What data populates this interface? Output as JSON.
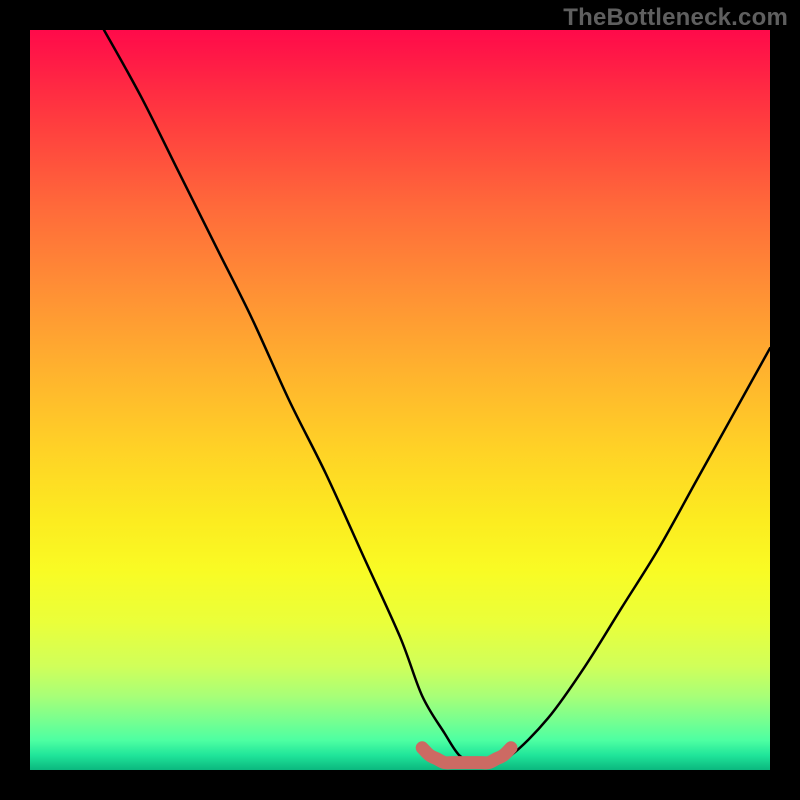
{
  "watermark": "TheBottleneck.com",
  "chart_data": {
    "type": "line",
    "title": "",
    "xlabel": "",
    "ylabel": "",
    "xlim": [
      0,
      100
    ],
    "ylim": [
      0,
      100
    ],
    "grid": false,
    "legend": false,
    "background_gradient": [
      "#ff0a4a",
      "#ffb22e",
      "#fceb20",
      "#20e59a"
    ],
    "series": [
      {
        "name": "bottleneck-curve",
        "color": "#000000",
        "x": [
          10,
          15,
          20,
          25,
          30,
          35,
          40,
          45,
          50,
          53,
          56,
          58,
          60,
          62,
          65,
          70,
          75,
          80,
          85,
          90,
          95,
          100
        ],
        "y": [
          100,
          91,
          81,
          71,
          61,
          50,
          40,
          29,
          18,
          10,
          5,
          2,
          1,
          1,
          2,
          7,
          14,
          22,
          30,
          39,
          48,
          57
        ]
      },
      {
        "name": "optimal-band",
        "color": "#cc6a63",
        "type": "area",
        "x": [
          53,
          54,
          55,
          56,
          57,
          58,
          59,
          60,
          61,
          62,
          63,
          64,
          65
        ],
        "y": [
          3,
          2,
          1.5,
          1,
          1,
          1,
          1,
          1,
          1,
          1,
          1.5,
          2,
          3
        ]
      }
    ],
    "annotations": []
  },
  "palette": {
    "curve": "#000000",
    "band": "#cc6a63",
    "watermark": "#5f5f5f"
  }
}
